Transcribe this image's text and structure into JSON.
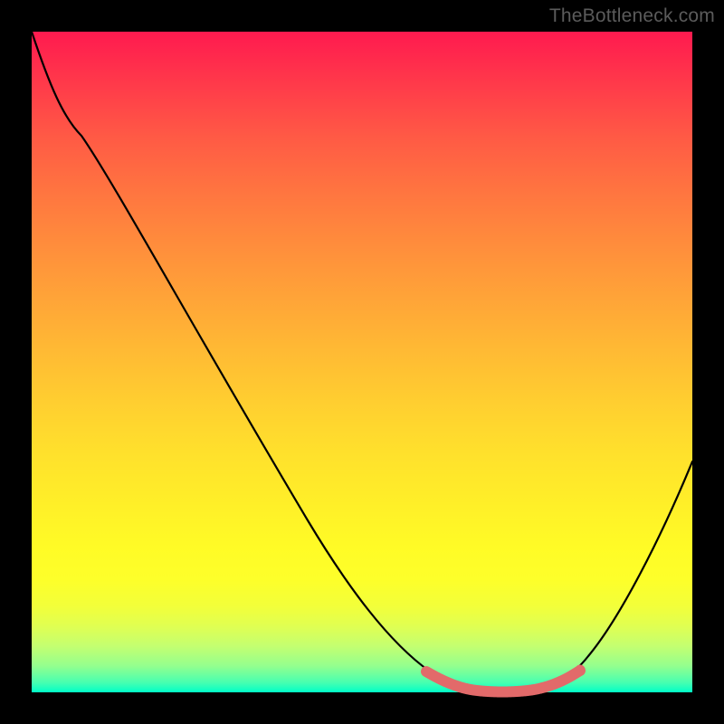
{
  "watermark": "TheBottleneck.com",
  "colors": {
    "gradient_top": "#ff1a4f",
    "gradient_bottom": "#00ffc8",
    "curve": "#000000",
    "highlight": "#e26a6a",
    "frame": "#000000"
  },
  "chart_data": {
    "type": "line",
    "title": "",
    "xlabel": "",
    "ylabel": "",
    "xlim": [
      0,
      100
    ],
    "ylim": [
      0,
      100
    ],
    "grid": false,
    "legend": false,
    "series": [
      {
        "name": "bottleneck-curve",
        "x": [
          0,
          5,
          8,
          12,
          20,
          30,
          40,
          50,
          55,
          60,
          65,
          70,
          75,
          80,
          83,
          85,
          90,
          95,
          100
        ],
        "y": [
          100,
          92,
          86,
          84,
          72,
          58,
          44,
          29,
          21,
          15,
          8,
          3,
          1,
          0,
          1,
          3,
          9,
          23,
          35
        ]
      }
    ],
    "annotations": [
      {
        "name": "optimal-band",
        "x_range": [
          60,
          83
        ],
        "y_approx": 2,
        "color": "#e26a6a",
        "note": "highlighted trough segment"
      }
    ]
  }
}
